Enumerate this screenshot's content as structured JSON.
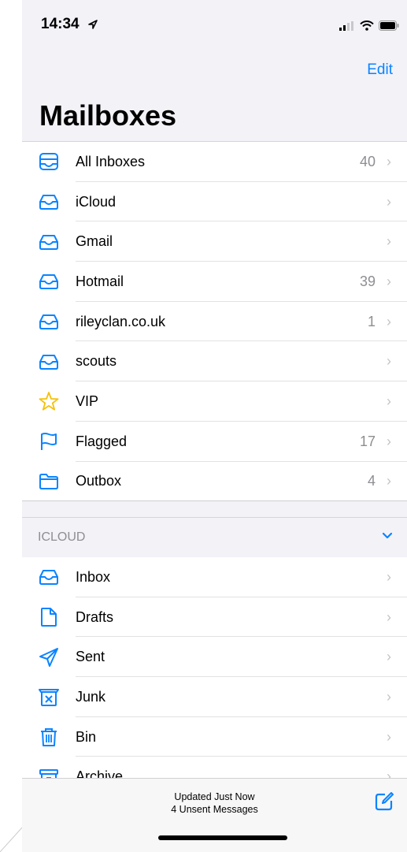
{
  "status": {
    "time": "14:34"
  },
  "header": {
    "edit_label": "Edit",
    "title": "Mailboxes"
  },
  "colors": {
    "accent": "#0a84ff",
    "vip": "#f4c20d"
  },
  "mailboxes": [
    {
      "label": "All Inboxes",
      "count": "40",
      "icon": "all-inboxes-icon"
    },
    {
      "label": "iCloud",
      "count": "",
      "icon": "inbox-tray-icon"
    },
    {
      "label": "Gmail",
      "count": "",
      "icon": "inbox-tray-icon"
    },
    {
      "label": "Hotmail",
      "count": "39",
      "icon": "inbox-tray-icon"
    },
    {
      "label": "rileyclan.co.uk",
      "count": "1",
      "icon": "inbox-tray-icon"
    },
    {
      "label": "scouts",
      "count": "",
      "icon": "inbox-tray-icon"
    },
    {
      "label": "VIP",
      "count": "",
      "icon": "star-icon"
    },
    {
      "label": "Flagged",
      "count": "17",
      "icon": "flag-icon"
    },
    {
      "label": "Outbox",
      "count": "4",
      "icon": "folder-icon"
    }
  ],
  "icloud_section": {
    "title": "ICLOUD",
    "items": [
      {
        "label": "Inbox",
        "icon": "inbox-tray-icon"
      },
      {
        "label": "Drafts",
        "icon": "document-icon"
      },
      {
        "label": "Sent",
        "icon": "paperplane-icon"
      },
      {
        "label": "Junk",
        "icon": "junk-icon"
      },
      {
        "label": "Bin",
        "icon": "trash-icon"
      },
      {
        "label": "Archive",
        "icon": "archive-icon"
      }
    ]
  },
  "toolbar": {
    "status_line1": "Updated Just Now",
    "status_line2": "4 Unsent Messages"
  }
}
